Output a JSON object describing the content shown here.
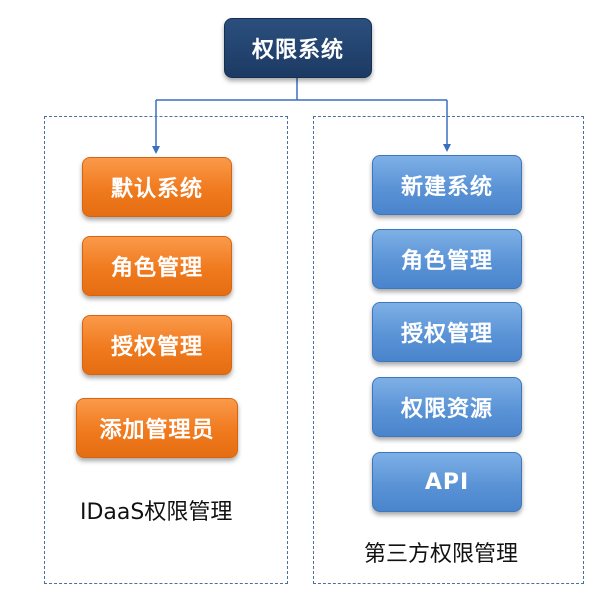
{
  "root": {
    "label": "权限系统"
  },
  "left_group": {
    "label": "IDaaS权限管理",
    "items": [
      {
        "label": "默认系统"
      },
      {
        "label": "角色管理"
      },
      {
        "label": "授权管理"
      },
      {
        "label": "添加管理员"
      }
    ]
  },
  "right_group": {
    "label": "第三方权限管理",
    "items": [
      {
        "label": "新建系统"
      },
      {
        "label": "角色管理"
      },
      {
        "label": "授权管理"
      },
      {
        "label": "权限资源"
      },
      {
        "label": "API"
      }
    ]
  },
  "colors": {
    "root": "#1f3f6a",
    "left_nodes": "#f07a1e",
    "right_nodes": "#5a93d6",
    "connector": "#3a6fc0",
    "group_border": "#4a6fa5"
  }
}
